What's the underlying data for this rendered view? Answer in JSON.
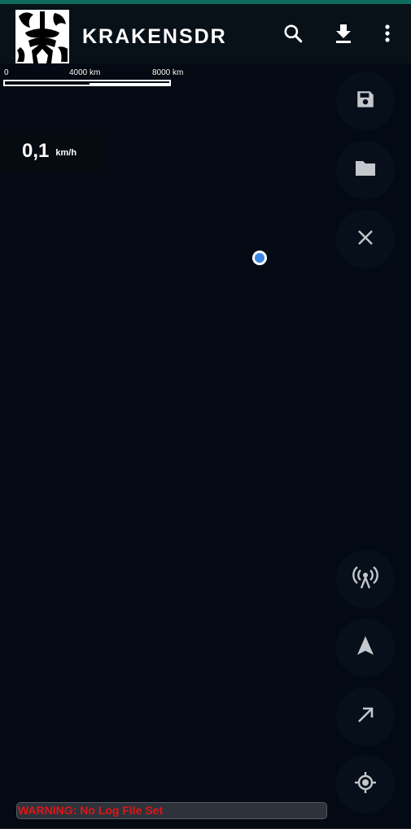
{
  "app": {
    "title": "KRAKENSDR",
    "logo_icon": "kraken-logo",
    "accent_color": "#0f6b5c"
  },
  "toolbar": {
    "search_icon": "search-icon",
    "download_icon": "download-icon",
    "more_icon": "more-vert-icon"
  },
  "scale": {
    "label_0": "0",
    "label_mid": "4000 km",
    "label_end": "8000 km"
  },
  "speed": {
    "value": "0,1",
    "unit": "km/h"
  },
  "fabs": [
    {
      "icon": "save-icon"
    },
    {
      "icon": "folder-icon"
    },
    {
      "icon": "close-icon"
    },
    {
      "icon": "antenna-icon"
    },
    {
      "icon": "navigation-arrow-icon"
    },
    {
      "icon": "arrow-northeast-icon"
    },
    {
      "icon": "my-location-icon"
    }
  ],
  "status": {
    "warning": "WARNING: No Log File Set",
    "warning_color": "#e01515"
  }
}
